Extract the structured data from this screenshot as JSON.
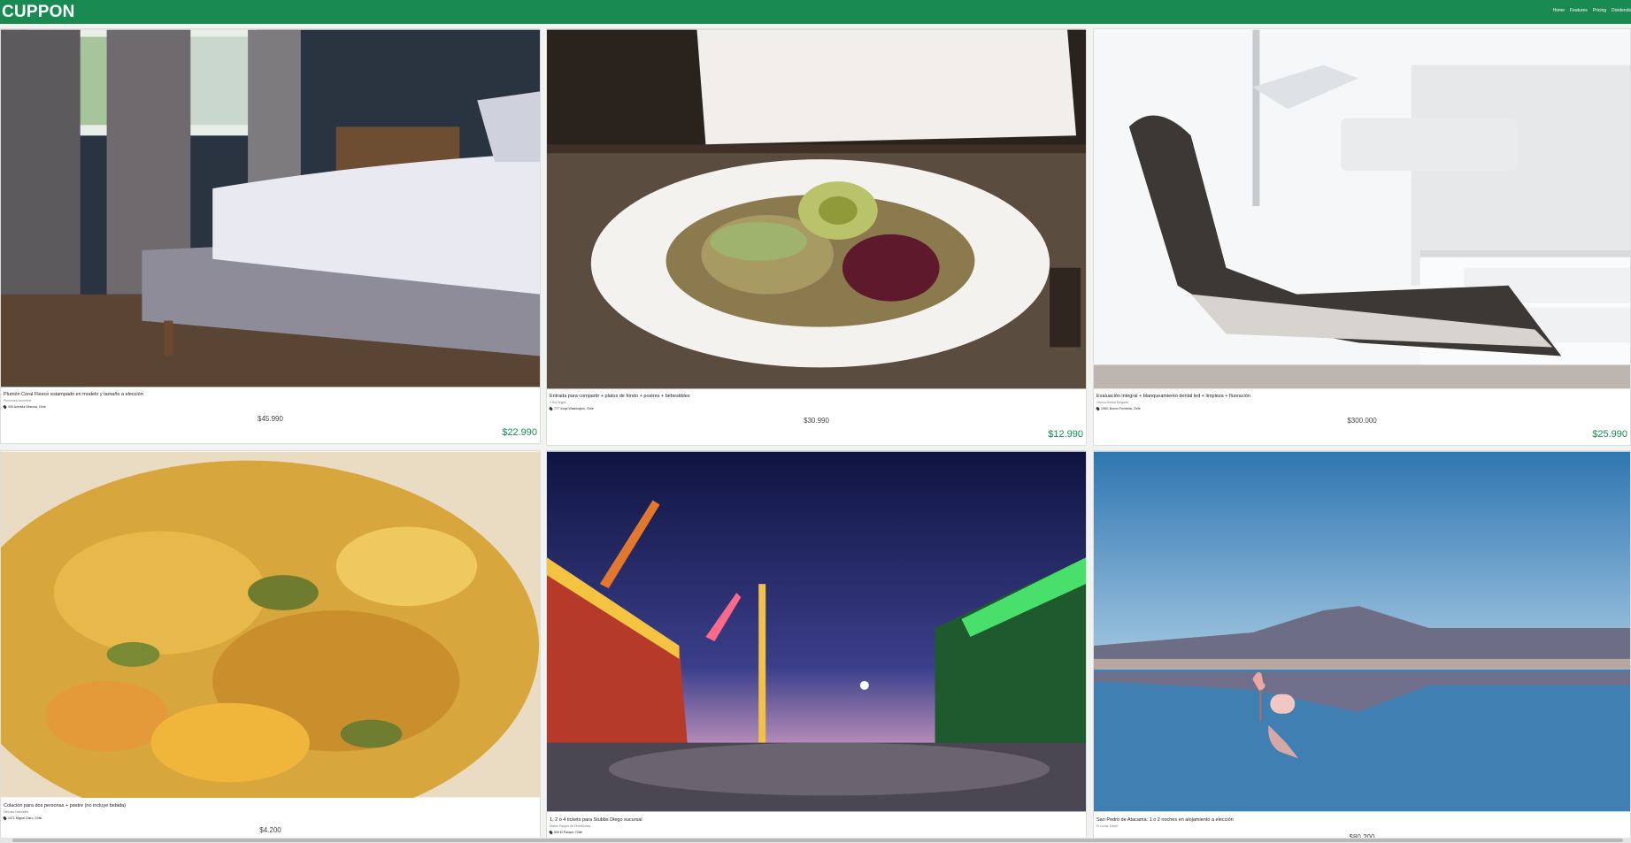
{
  "header": {
    "brand": "CUPPON",
    "nav": [
      "Home",
      "Features",
      "Pricing",
      "Dividends"
    ]
  },
  "colors": {
    "brand_green": "#1a8a53",
    "deal_price": "#1a8a53"
  },
  "deals": [
    {
      "title": "Plumón Coral Fleece estampado en modelo y tamaño a elección",
      "merchant": "Plumones Incomfort",
      "location": "905 Avenida Vitacura, Chile",
      "original_price": "$45.990",
      "deal_price": "$22.990",
      "image": "bed-photo"
    },
    {
      "title": "Entrada para compartir + platos de fondo + postres + bebestibles",
      "merchant": "Il Sol Vegan",
      "location": "777 Jorge Washington, Chile",
      "original_price": "$30.990",
      "deal_price": "$12.990",
      "image": "salad-photo"
    },
    {
      "title": "Evaluación integral + blanqueamiento dental led + limpieza + fluoración",
      "merchant": "Clínica Dental Delgado",
      "location": "1950, Bueno Fronteria, Chile",
      "original_price": "$300.000",
      "deal_price": "$25.990",
      "image": "dental-chair-photo"
    },
    {
      "title": "Colación para dos personas + postre (no incluye bebida)",
      "merchant": "Delicias Naturales",
      "location": "1071 Miguel Claro, Chile",
      "original_price": "$4.200",
      "deal_price": "",
      "image": "food-close-up-photo"
    },
    {
      "title": "1, 2 o 4 tickets para Stubbs Diego sucursal",
      "merchant": "Diablo Parque de Diversiones",
      "location": "505 El Parque, Chile",
      "original_price": "",
      "deal_price": "",
      "image": "fair-night-photo"
    },
    {
      "title": "San Pedro de Atacama: 1 o 2 noches en alojamiento a elección",
      "merchant": "El Lucas Travel",
      "location": "",
      "original_price": "$80.200",
      "deal_price": "",
      "image": "flamingo-photo"
    }
  ]
}
